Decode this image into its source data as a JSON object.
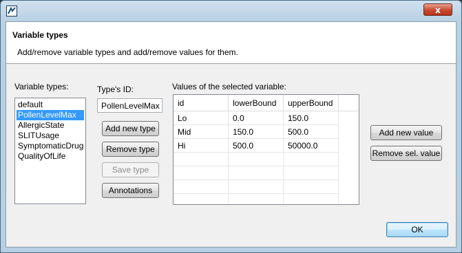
{
  "dialog": {
    "title_icon": "app-icon",
    "close_glyph": "x",
    "header_title": "Variable types",
    "header_description": "Add/remove variable types and add/remove values for them."
  },
  "variable_types": {
    "label": "Variable types:",
    "items": [
      "default",
      "PollenLevelMax",
      "AllergicState",
      "SLITUsage",
      "SymptomaticDrug",
      "QualityOfLife"
    ],
    "selected": "PollenLevelMax"
  },
  "type_id": {
    "label": "Type's ID:",
    "value": "PollenLevelMax"
  },
  "buttons": {
    "add_new_type": "Add new type",
    "remove_type": "Remove type",
    "save_type": "Save type",
    "annotations": "Annotations",
    "add_new_value": "Add new value",
    "remove_sel_value": "Remove sel. value",
    "ok": "OK"
  },
  "values_table": {
    "label": "Values of the selected variable:",
    "columns": [
      "id",
      "lowerBound",
      "upperBound"
    ],
    "rows": [
      [
        "Lo",
        "0.0",
        "150.0"
      ],
      [
        "Mid",
        "150.0",
        "500.0"
      ],
      [
        "Hi",
        "500.0",
        "50000.0"
      ]
    ]
  },
  "colors": {
    "selection": "#3399ff",
    "close_button": "#c84a30"
  }
}
